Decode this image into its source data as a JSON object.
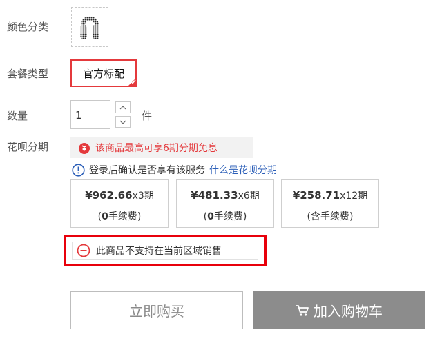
{
  "labels": {
    "color": "颜色分类",
    "package": "套餐类型",
    "quantity": "数量",
    "huabei": "花呗分期"
  },
  "package_option": "官方标配",
  "quantity": {
    "value": "1",
    "unit": "件"
  },
  "promo": {
    "text": "该商品最高可享6期分期免息",
    "color": "#e4393c"
  },
  "notice": {
    "text": "登录后确认是否享有该服务",
    "link": "什么是花呗分期"
  },
  "installments": [
    {
      "amount": "¥962.66",
      "periods": "x3期",
      "fee_open": "(",
      "fee_zero": "0",
      "fee_text": "手续费)"
    },
    {
      "amount": "¥481.33",
      "periods": "x6期",
      "fee_open": "(",
      "fee_zero": "0",
      "fee_text": "手续费)"
    },
    {
      "amount": "¥258.71",
      "periods": "x12期",
      "fee_text": "(含手续费)"
    }
  ],
  "warning": "此商品不支持在当前区域销售",
  "buttons": {
    "buy_now": "立即购买",
    "add_to_cart": "加入购物车"
  },
  "colors": {
    "accent": "#e4393c",
    "highlight_border": "#e8000b",
    "link": "#2c5fb8",
    "cart_bg": "#8c8c8c"
  }
}
